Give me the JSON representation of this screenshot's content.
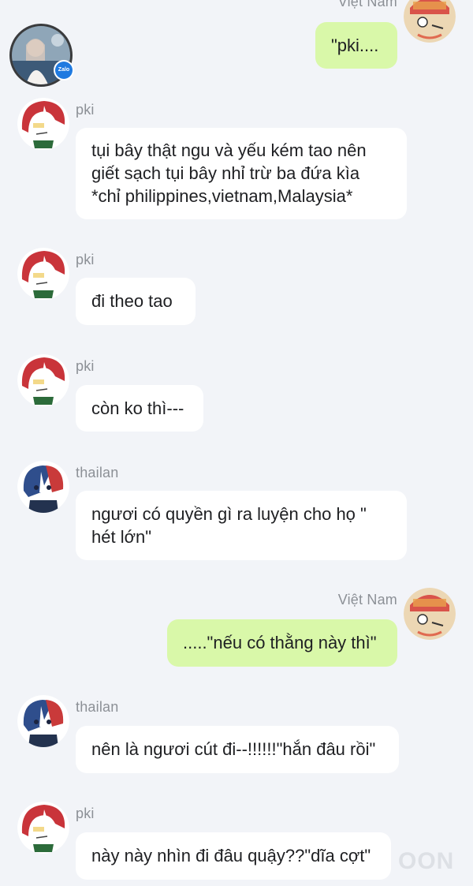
{
  "contact": {
    "avatar_name": "contact-profile-avatar",
    "badge_text": "Zalo"
  },
  "messages": [
    {
      "sender": "Việt Nam",
      "text": "\"pki....",
      "mine": true
    },
    {
      "sender": "pki",
      "text": "tụi bây thật ngu và yếu kém tao nên\ngiết sạch tụi bây nhỉ trừ ba đứa kìa\n*chỉ philippines,vietnam,Malaysia*",
      "mine": false
    },
    {
      "sender": "pki",
      "text": "đi theo tao",
      "mine": false
    },
    {
      "sender": "pki",
      "text": "còn ko thì---",
      "mine": false
    },
    {
      "sender": "thailan",
      "text": "ngươi có quyền gì ra luyện cho họ \"\nhét lớn\"",
      "mine": false
    },
    {
      "sender": "Việt Nam",
      "text": ".....\"nếu có thằng này thì\"",
      "mine": true
    },
    {
      "sender": "thailan",
      "text": "nên là ngươi cút đi--!!!!!!\"hắn đâu rồi\"",
      "mine": false
    },
    {
      "sender": "pki",
      "text": "này này nhìn đi đâu quậy??\"dĩa cợt\"",
      "mine": false
    }
  ],
  "watermark": "OON",
  "colors": {
    "background": "#f2f4f8",
    "bubble_other": "#ffffff",
    "bubble_mine": "#d9f8a9",
    "sender_name": "#8c9096"
  }
}
